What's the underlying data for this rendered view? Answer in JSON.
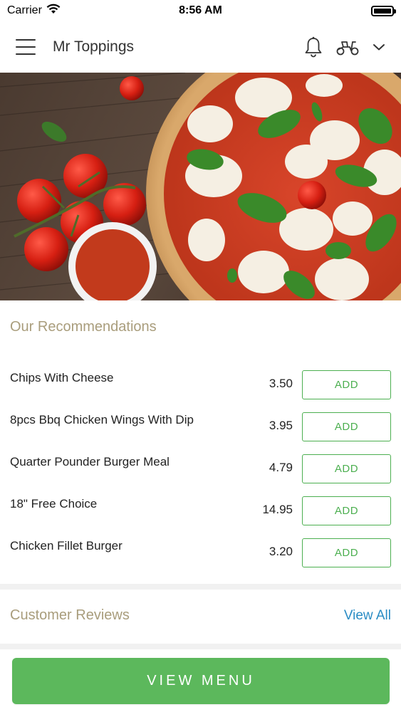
{
  "status_bar": {
    "carrier": "Carrier",
    "time": "8:56 AM",
    "icons": [
      "wifi-icon",
      "battery-icon"
    ]
  },
  "header": {
    "title": "Mr Toppings",
    "icons": [
      "menu-icon",
      "bell-icon",
      "scooter-icon",
      "chevron-down-icon"
    ]
  },
  "hero": {
    "description_icon": "pizza-hero-image"
  },
  "recommendations": {
    "title": "Our Recommendations",
    "items": [
      {
        "name": "Chips With Cheese",
        "price": "3.50",
        "button": "ADD"
      },
      {
        "name": "8pcs Bbq Chicken Wings With Dip",
        "price": "3.95",
        "button": "ADD"
      },
      {
        "name": "Quarter Pounder Burger Meal",
        "price": "4.79",
        "button": "ADD"
      },
      {
        "name": "18\" Free Choice",
        "price": "14.95",
        "button": "ADD"
      },
      {
        "name": "Chicken Fillet Burger",
        "price": "3.20",
        "button": "ADD"
      }
    ]
  },
  "reviews": {
    "title": "Customer Reviews",
    "view_all": "View All"
  },
  "cta": {
    "label": "VIEW MENU"
  },
  "colors": {
    "accent_green": "#4caf50",
    "cta_green": "#5cb85c",
    "section_title": "#a99d7c",
    "link_blue": "#2a8cc4"
  }
}
